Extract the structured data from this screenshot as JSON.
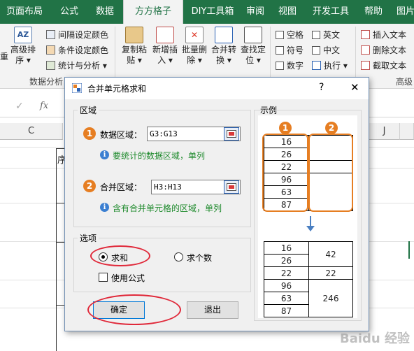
{
  "ribbon_tabs": [
    "页面布局",
    "公式",
    "数据",
    "方方格子",
    "DIY工具箱",
    "审阅",
    "视图",
    "开发工具",
    "帮助",
    "图片"
  ],
  "active_tab_index": 3,
  "ribbon": {
    "left_partial_1": "重",
    "left_partial_2": "排序",
    "advanced_sort": "高级排",
    "advanced_sort_2": "序",
    "interval_color": "间隔设定颜色",
    "conditional_color": "条件设定颜色",
    "stats_analysis": "统计与分析",
    "group_data_analysis": "数据分析",
    "copy_paste_1": "复制粘",
    "copy_paste_2": "贴",
    "new_insert_1": "新增插",
    "new_insert_2": "入",
    "batch_delete_1": "批量删",
    "batch_delete_2": "除",
    "merge_convert_1": "合并转",
    "merge_convert_2": "换",
    "find_locate_1": "查找定",
    "find_locate_2": "位",
    "space": "空格",
    "english": "英文",
    "symbol": "符号",
    "chinese": "中文",
    "digit": "数字",
    "execute": "执行",
    "insert_text": "插入文本",
    "delete_text": "删除文本",
    "extract_text": "截取文本",
    "group_advanced": "高级"
  },
  "formula_bar": {
    "fx": "fx",
    "check": "✓"
  },
  "sheet": {
    "col_c": "C",
    "col_j": "J",
    "cell_partial": "序"
  },
  "dialog": {
    "title": "合并单元格求和",
    "help": "?",
    "close": "✕",
    "region_legend": "区域",
    "data_region_label": "数据区域：",
    "data_region_value": "G3:G13",
    "data_region_hint": "要统计的数据区域，单列",
    "merge_region_label": "合并区域：",
    "merge_region_value": "H3:H13",
    "merge_region_hint": "含有合并单元格的区域，单列",
    "options_legend": "选项",
    "opt_sum": "求和",
    "opt_count": "求个数",
    "opt_use_formula": "使用公式",
    "ok_button": "确定",
    "exit_button": "退出",
    "example_legend": "示例",
    "circle_1": "1",
    "circle_2": "2",
    "info_glyph": "i"
  },
  "example": {
    "before_values": [
      "16",
      "26",
      "22",
      "96",
      "63",
      "87"
    ],
    "after_values": [
      "16",
      "26",
      "22",
      "96",
      "63",
      "87"
    ],
    "after_sums": [
      "42",
      "22",
      "246"
    ]
  },
  "watermark": "Baidu 经验",
  "colors": {
    "ribbon_green": "#217346",
    "accent_orange": "#e67e22",
    "annotation_red": "#e0293a",
    "hint_green": "#1e8a2c"
  }
}
